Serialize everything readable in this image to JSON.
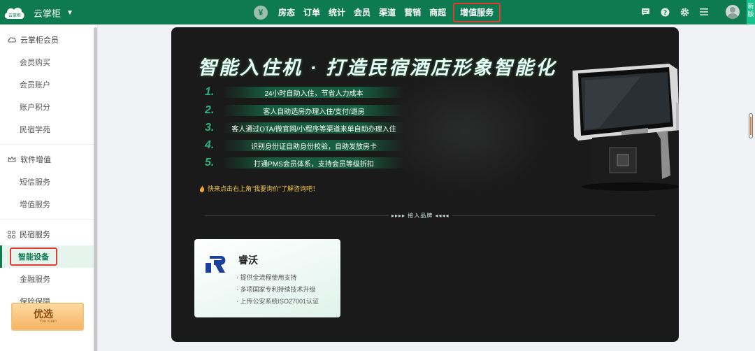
{
  "topbar": {
    "logo_text": "云掌柜",
    "brand": "云掌柜",
    "nav_items": [
      "房态",
      "订单",
      "统计",
      "会员",
      "渠道",
      "营销",
      "商超",
      "增值服务"
    ],
    "active_nav": "增值服务",
    "corner_text": "新版"
  },
  "sidebar": {
    "groups": [
      {
        "title": "云掌柜会员",
        "items": [
          "会员购买",
          "会员账户",
          "账户积分",
          "民宿学苑"
        ]
      },
      {
        "title": "软件增值",
        "items": [
          "短信服务",
          "增值服务"
        ]
      },
      {
        "title": "民宿服务",
        "items": [
          "智能设备",
          "金融服务",
          "保险保障"
        ]
      }
    ],
    "active_item": "智能设备",
    "promo_title": "优选",
    "promo_sub": "You xuan"
  },
  "banner": {
    "headline": "智能入住机 · 打造民宿酒店形象智能化",
    "features": [
      {
        "num": "1.",
        "text": "24小时自助入住，节省人力成本"
      },
      {
        "num": "2.",
        "text": "客人自助选房办理入住/支付/退房"
      },
      {
        "num": "3.",
        "text": "客人通过OTA/微官网/小程序等渠道来单自助办理入住"
      },
      {
        "num": "4.",
        "text": "识别身份证自助身份校验，自助发放房卡"
      },
      {
        "num": "5.",
        "text": "打通PMS会员体系，支持会员等级折扣"
      }
    ],
    "tip": "快来点击右上角“我要询价”了解咨询吧！",
    "brands_label": "▸▸▸▸  接入品牌  ◂◂◂◂"
  },
  "brand_card": {
    "name": "睿沃",
    "lines": [
      "· 提供全流程使用支持",
      "· 多项国家专利持续技术升级",
      "· 上传公安系统ISO27001认证"
    ]
  },
  "colors": {
    "primary": "#0d7a4f",
    "highlight": "#e53935",
    "tip": "#f3c544"
  }
}
